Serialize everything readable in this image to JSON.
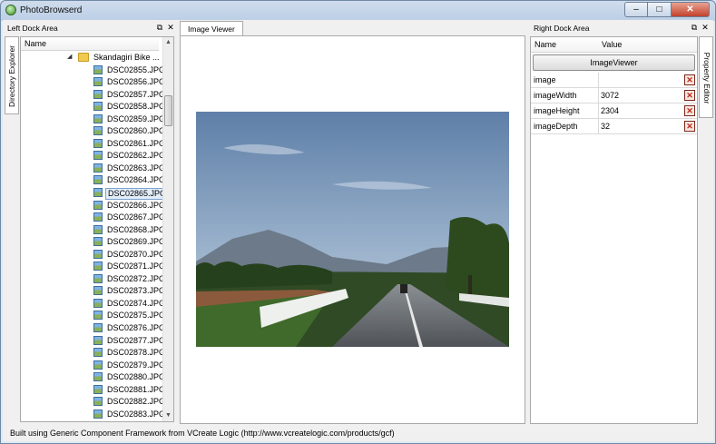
{
  "window": {
    "title": "PhotoBrowserd"
  },
  "left_dock": {
    "title": "Left Dock Area",
    "tab_label": "Directory Explorer",
    "header": "Name",
    "folder": "Skandagiri Bike ...",
    "files": [
      "DSC02855.JPG",
      "DSC02856.JPG",
      "DSC02857.JPG",
      "DSC02858.JPG",
      "DSC02859.JPG",
      "DSC02860.JPG",
      "DSC02861.JPG",
      "DSC02862.JPG",
      "DSC02863.JPG",
      "DSC02864.JPG",
      "DSC02865.JPG",
      "DSC02866.JPG",
      "DSC02867.JPG",
      "DSC02868.JPG",
      "DSC02869.JPG",
      "DSC02870.JPG",
      "DSC02871.JPG",
      "DSC02872.JPG",
      "DSC02873.JPG",
      "DSC02874.JPG",
      "DSC02875.JPG",
      "DSC02876.JPG",
      "DSC02877.JPG",
      "DSC02878.JPG",
      "DSC02879.JPG",
      "DSC02880.JPG",
      "DSC02881.JPG",
      "DSC02882.JPG",
      "DSC02883.JPG"
    ],
    "selected_file": "DSC02865.JPG"
  },
  "center": {
    "tab_label": "Image Viewer"
  },
  "right_dock": {
    "title": "Right Dock Area",
    "tab_label": "Property Editor",
    "col_name": "Name",
    "col_value": "Value",
    "object_button": "ImageViewer",
    "properties": [
      {
        "name": "image",
        "value": ""
      },
      {
        "name": "imageWidth",
        "value": "3072"
      },
      {
        "name": "imageHeight",
        "value": "2304"
      },
      {
        "name": "imageDepth",
        "value": "32"
      }
    ]
  },
  "status": "Built using Generic Component Framework from VCreate Logic (http://www.vcreatelogic.com/products/gcf)",
  "icons": {
    "app": "app-logo-icon",
    "minimize": "minimize-icon",
    "maximize": "maximize-icon",
    "close": "close-icon",
    "float": "float-dock-icon",
    "dock_close": "close-dock-icon",
    "delete": "delete-property-icon",
    "folder": "folder-icon",
    "file": "image-file-icon"
  }
}
